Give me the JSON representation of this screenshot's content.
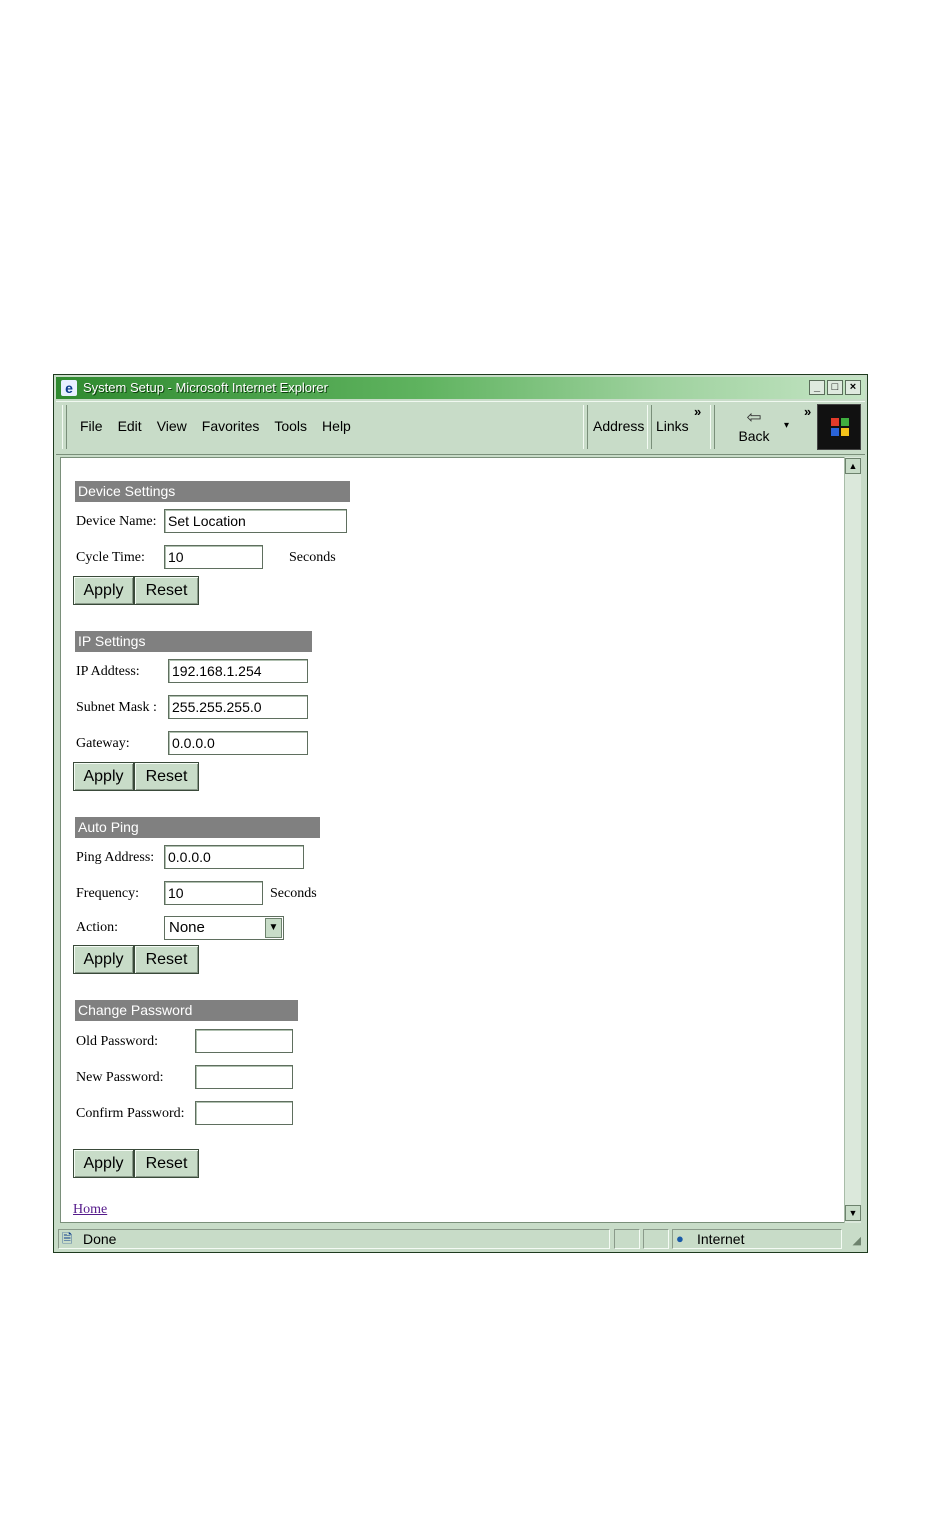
{
  "window": {
    "title": "System Setup - Microsoft Internet Explorer",
    "controls": {
      "minimize": "_",
      "maximize": "□",
      "close": "×"
    }
  },
  "toolbar": {
    "menu": [
      "File",
      "Edit",
      "View",
      "Favorites",
      "Tools",
      "Help"
    ],
    "address_label": "Address",
    "links_label": "Links",
    "chevron": "»",
    "back_label": "Back",
    "back_dropdown": "▾"
  },
  "device_settings": {
    "header": "Device Settings",
    "device_name_label": "Device Name:",
    "device_name_value": "Set Location",
    "cycle_time_label": "Cycle Time:",
    "cycle_time_value": "10",
    "cycle_time_unit": "Seconds",
    "apply": "Apply",
    "reset": "Reset"
  },
  "ip_settings": {
    "header": "IP Settings",
    "ip_label": "IP Addtess:",
    "ip_value": "192.168.1.254",
    "subnet_label": "Subnet Mask :",
    "subnet_value": "255.255.255.0",
    "gateway_label": "Gateway:",
    "gateway_value": "0.0.0.0",
    "apply": "Apply",
    "reset": "Reset"
  },
  "auto_ping": {
    "header": "Auto Ping",
    "ping_label": "Ping Address:",
    "ping_value": "0.0.0.0",
    "frequency_label": "Frequency:",
    "frequency_value": "10",
    "frequency_unit": "Seconds",
    "action_label": "Action:",
    "action_value": "None",
    "apply": "Apply",
    "reset": "Reset"
  },
  "change_password": {
    "header": "Change Password",
    "old_label": "Old Password:",
    "new_label": "New Password:",
    "confirm_label": "Confirm Password:",
    "old_value": "",
    "new_value": "",
    "confirm_value": "",
    "apply": "Apply",
    "reset": "Reset"
  },
  "home_link": "Home",
  "status": {
    "text": "Done",
    "zone": "Internet"
  },
  "colors": {
    "section_header_bg": "#808080",
    "window_bg": "#c8dcc8",
    "title_gradient_start": "#2f8a2f",
    "link_visited": "#551a8b"
  }
}
